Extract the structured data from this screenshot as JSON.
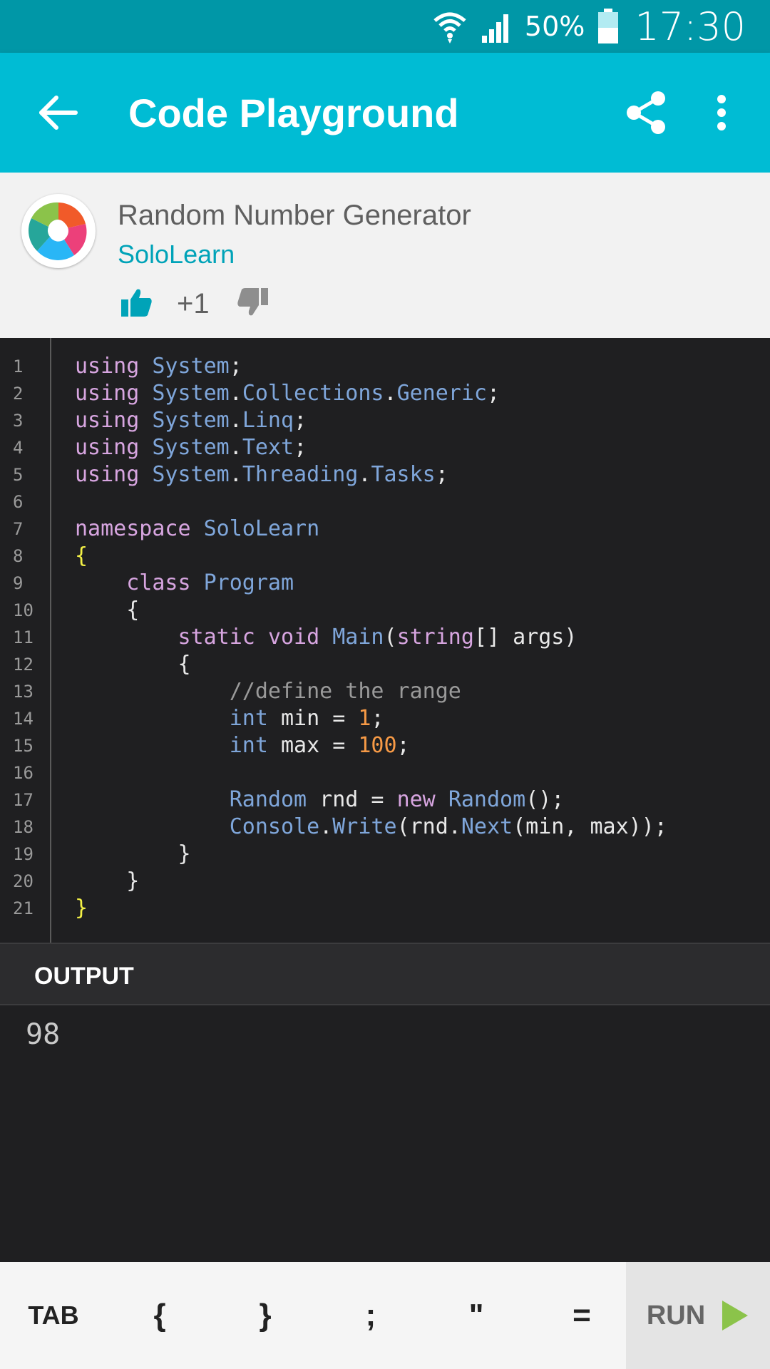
{
  "status_bar": {
    "battery_percent": "50%",
    "time": "17:30"
  },
  "app_bar": {
    "title": "Code Playground",
    "icons": [
      "arrow-back-icon",
      "share-icon",
      "more-vert-icon"
    ]
  },
  "header": {
    "code_name": "Random Number Generator",
    "author": "SoloLearn",
    "vote_count": "+1"
  },
  "editor": {
    "line_numbers": [
      "1",
      "2",
      "3",
      "4",
      "5",
      "6",
      "7",
      "8",
      "9",
      "10",
      "11",
      "12",
      "13",
      "14",
      "15",
      "16",
      "17",
      "18",
      "19",
      "20",
      "21"
    ]
  },
  "output": {
    "header": "OUTPUT",
    "text": "98"
  },
  "toolbar": {
    "tab": "TAB",
    "symbols": [
      "{",
      "}",
      ";",
      "\"",
      "="
    ],
    "run": "RUN"
  },
  "colors": {
    "status_bar": "#0097a7",
    "app_bar": "#00bcd4",
    "accent": "#00a3b8",
    "editor_bg": "#1f1f21",
    "run_arrow": "#8bc34a"
  }
}
